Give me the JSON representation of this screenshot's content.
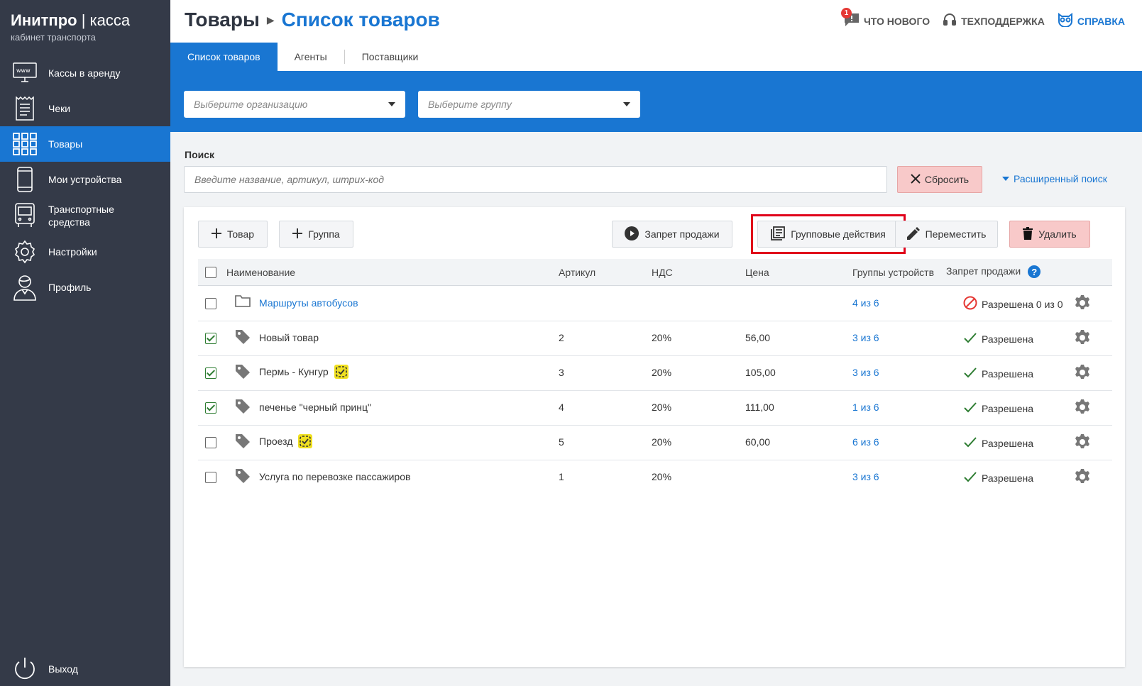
{
  "app": {
    "brand_name": "Инитпро",
    "brand_sep": " | ",
    "brand_product": "касса",
    "brand_sub": "кабинет транспорта"
  },
  "sidebar": {
    "items": [
      {
        "label": "Кассы в аренду",
        "icon": "www-monitor-icon"
      },
      {
        "label": "Чеки",
        "icon": "receipt-icon"
      },
      {
        "label": "Товары",
        "icon": "grid-icon",
        "active": true
      },
      {
        "label": "Мои устройства",
        "icon": "phone-icon"
      },
      {
        "label": "Транспортные средства",
        "icon": "bus-icon"
      },
      {
        "label": "Настройки",
        "icon": "gear-icon"
      },
      {
        "label": "Профиль",
        "icon": "user-icon"
      }
    ],
    "logout_label": "Выход"
  },
  "header": {
    "breadcrumb_parent": "Товары",
    "breadcrumb_current": "Список товаров",
    "whats_new": "ЧТО НОВОГО",
    "whats_new_badge": "1",
    "support": "ТЕХПОДДЕРЖКА",
    "help": "СПРАВКА"
  },
  "tabs": [
    {
      "label": "Список товаров",
      "active": true
    },
    {
      "label": "Агенты"
    },
    {
      "label": "Поставщики"
    }
  ],
  "filters": {
    "organization_placeholder": "Выберите организацию",
    "group_placeholder": "Выберите группу"
  },
  "search": {
    "label": "Поиск",
    "placeholder": "Введите название, артикул, штрих-код",
    "reset_label": "Сбросить",
    "advanced_label": "Расширенный поиск"
  },
  "toolbar": {
    "add_product": "Товар",
    "add_group": "Группа",
    "ban_sale": "Запрет продажи",
    "group_actions": "Групповые действия",
    "move": "Переместить",
    "delete": "Удалить"
  },
  "table": {
    "columns": {
      "name": "Наименование",
      "article": "Артикул",
      "vat": "НДС",
      "price": "Цена",
      "device_groups": "Группы устройств",
      "sale_ban": "Запрет продажи"
    },
    "rows": [
      {
        "type": "folder",
        "checked": false,
        "name": "Маршруты автобусов",
        "article": "",
        "vat": "",
        "price": "",
        "device_groups": "4 из 6",
        "status": "Разрешена 0 из 0",
        "status_kind": "banned-icon",
        "marked": false
      },
      {
        "type": "product",
        "checked": true,
        "name": "Новый товар",
        "article": "2",
        "vat": "20%",
        "price": "56,00",
        "device_groups": "3 из 6",
        "status": "Разрешена",
        "status_kind": "check-icon",
        "marked": false
      },
      {
        "type": "product",
        "checked": true,
        "name": "Пермь - Кунгур",
        "article": "3",
        "vat": "20%",
        "price": "105,00",
        "device_groups": "3 из 6",
        "status": "Разрешена",
        "status_kind": "check-icon",
        "marked": true
      },
      {
        "type": "product",
        "checked": true,
        "name": "печенье \"черный принц\"",
        "article": "4",
        "vat": "20%",
        "price": "111,00",
        "device_groups": "1 из 6",
        "status": "Разрешена",
        "status_kind": "check-icon",
        "marked": false
      },
      {
        "type": "product",
        "checked": false,
        "name": "Проезд",
        "article": "5",
        "vat": "20%",
        "price": "60,00",
        "device_groups": "6 из 6",
        "status": "Разрешена",
        "status_kind": "check-icon",
        "marked": true
      },
      {
        "type": "product",
        "checked": false,
        "name": "Услуга по перевозке пассажиров",
        "article": "1",
        "vat": "20%",
        "price": "",
        "device_groups": "3 из 6",
        "status": "Разрешена",
        "status_kind": "check-icon",
        "marked": false
      }
    ]
  },
  "colors": {
    "sidebar_bg": "#343a48",
    "accent": "#1976d2",
    "danger_bg": "#f8c9c9",
    "highlight_border": "#e0001a",
    "check_green": "#2e7d32"
  }
}
